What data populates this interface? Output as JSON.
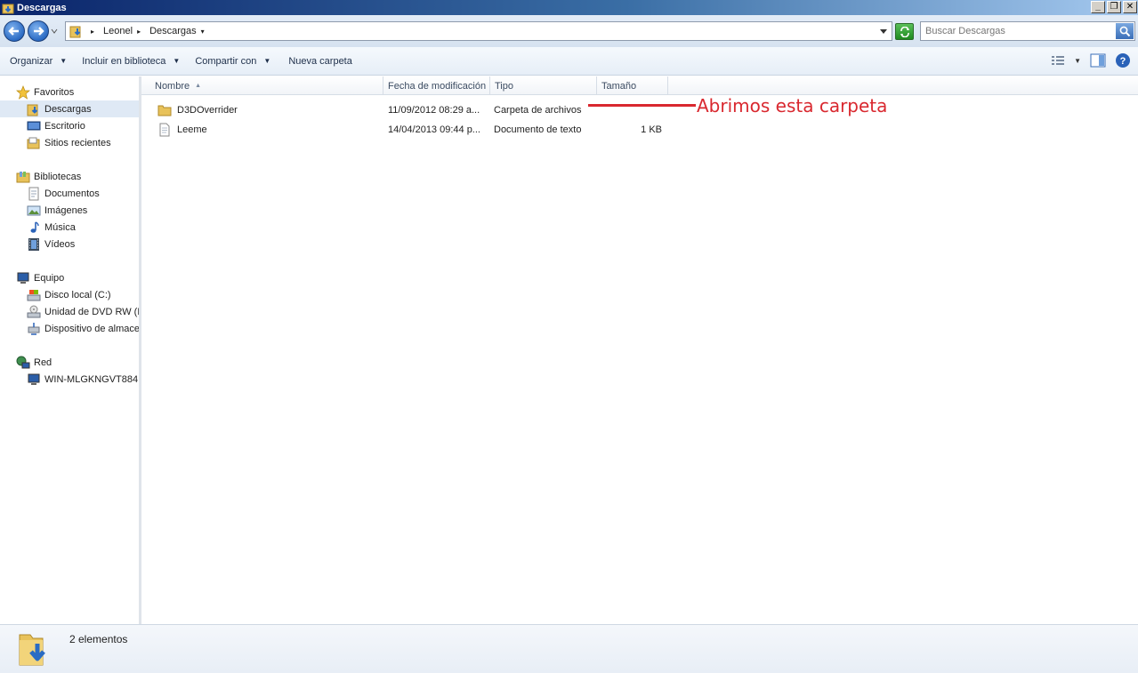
{
  "window": {
    "title": "Descargas"
  },
  "window_buttons": {
    "minimize": "_",
    "maximize": "❐",
    "close": "✕"
  },
  "address": {
    "crumbs": [
      "Leonel",
      "Descargas"
    ]
  },
  "search": {
    "placeholder": "Buscar Descargas"
  },
  "commands": {
    "organize": "Organizar",
    "include_library": "Incluir en biblioteca",
    "share_with": "Compartir con",
    "new_folder": "Nueva carpeta"
  },
  "nav": {
    "favorites": {
      "label": "Favoritos",
      "items": [
        "Descargas",
        "Escritorio",
        "Sitios recientes"
      ]
    },
    "libraries": {
      "label": "Bibliotecas",
      "items": [
        "Documentos",
        "Imágenes",
        "Música",
        "Vídeos"
      ]
    },
    "computer": {
      "label": "Equipo",
      "items": [
        "Disco local (C:)",
        "Unidad de DVD RW (D",
        "Dispositivo de almacen"
      ]
    },
    "network": {
      "label": "Red",
      "items": [
        "WIN-MLGKNGVT884"
      ]
    },
    "selected": "Descargas"
  },
  "columns": {
    "name": "Nombre",
    "date": "Fecha de modificación",
    "type": "Tipo",
    "size": "Tamaño"
  },
  "files": [
    {
      "name": "D3DOverrider",
      "date": "11/09/2012 08:29 a...",
      "type": "Carpeta de archivos",
      "size": "",
      "icon": "folder-icon"
    },
    {
      "name": "Leeme",
      "date": "14/04/2013 09:44 p...",
      "type": "Documento de texto",
      "size": "1 KB",
      "icon": "text-file-icon"
    }
  ],
  "annotation": {
    "text": "Abrimos esta carpeta",
    "color": "#d9282f"
  },
  "status": {
    "count": "2 elementos"
  }
}
